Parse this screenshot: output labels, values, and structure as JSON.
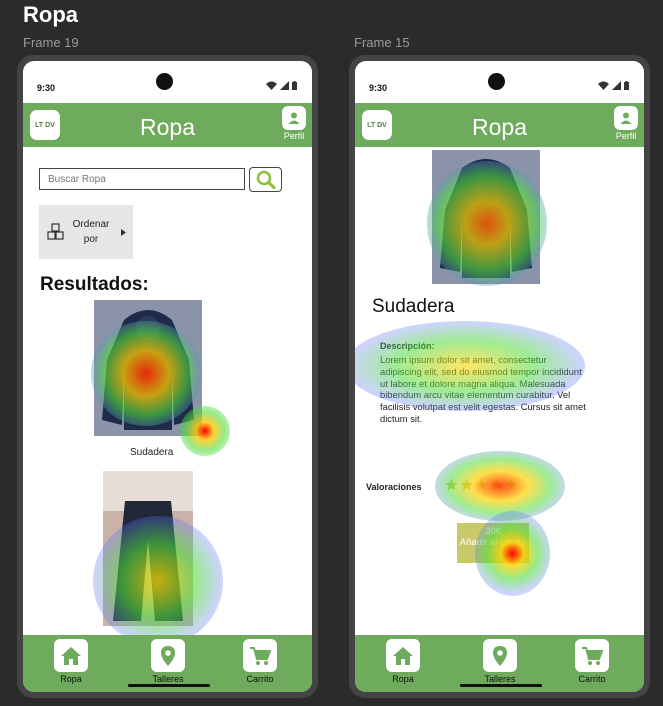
{
  "page_title": "Ropa",
  "frames": {
    "left_label": "Frame 19",
    "right_label": "Frame 15"
  },
  "status_bar": {
    "time": "9:30"
  },
  "app_bar": {
    "logo_text": "LT DV",
    "title": "Ropa",
    "profile_label": "Perfil"
  },
  "search": {
    "placeholder": "Buscar Ropa"
  },
  "sort": {
    "label": "Ordenar por"
  },
  "results": {
    "title": "Resultados:",
    "items": [
      {
        "caption": "Sudadera"
      },
      {
        "caption": ""
      }
    ]
  },
  "detail": {
    "name": "Sudadera",
    "description_title": "Descripción:",
    "description": "Lorem ipsum dolor sit amet, consectetur adipiscing elit, sed do eiusmod tempor incididunt ut labore et dolore magna aliqua. Malesuada bibendum arcu vitae elementum curabitur. Vel facilisis volutpat est velit egestas. Cursus sit amet dictum sit.",
    "ratings_label": "Valoraciones",
    "stars": 5,
    "price": "30€",
    "cart_button": "Añadir al carrito"
  },
  "bottom_nav": {
    "items": [
      {
        "label": "Ropa",
        "icon": "home-icon"
      },
      {
        "label": "Talleres",
        "icon": "location-pin-icon"
      },
      {
        "label": "Carrito",
        "icon": "cart-icon"
      }
    ]
  },
  "colors": {
    "background": "#2b2b2b",
    "brand_green": "#6fab5c",
    "frame": "#444444"
  }
}
